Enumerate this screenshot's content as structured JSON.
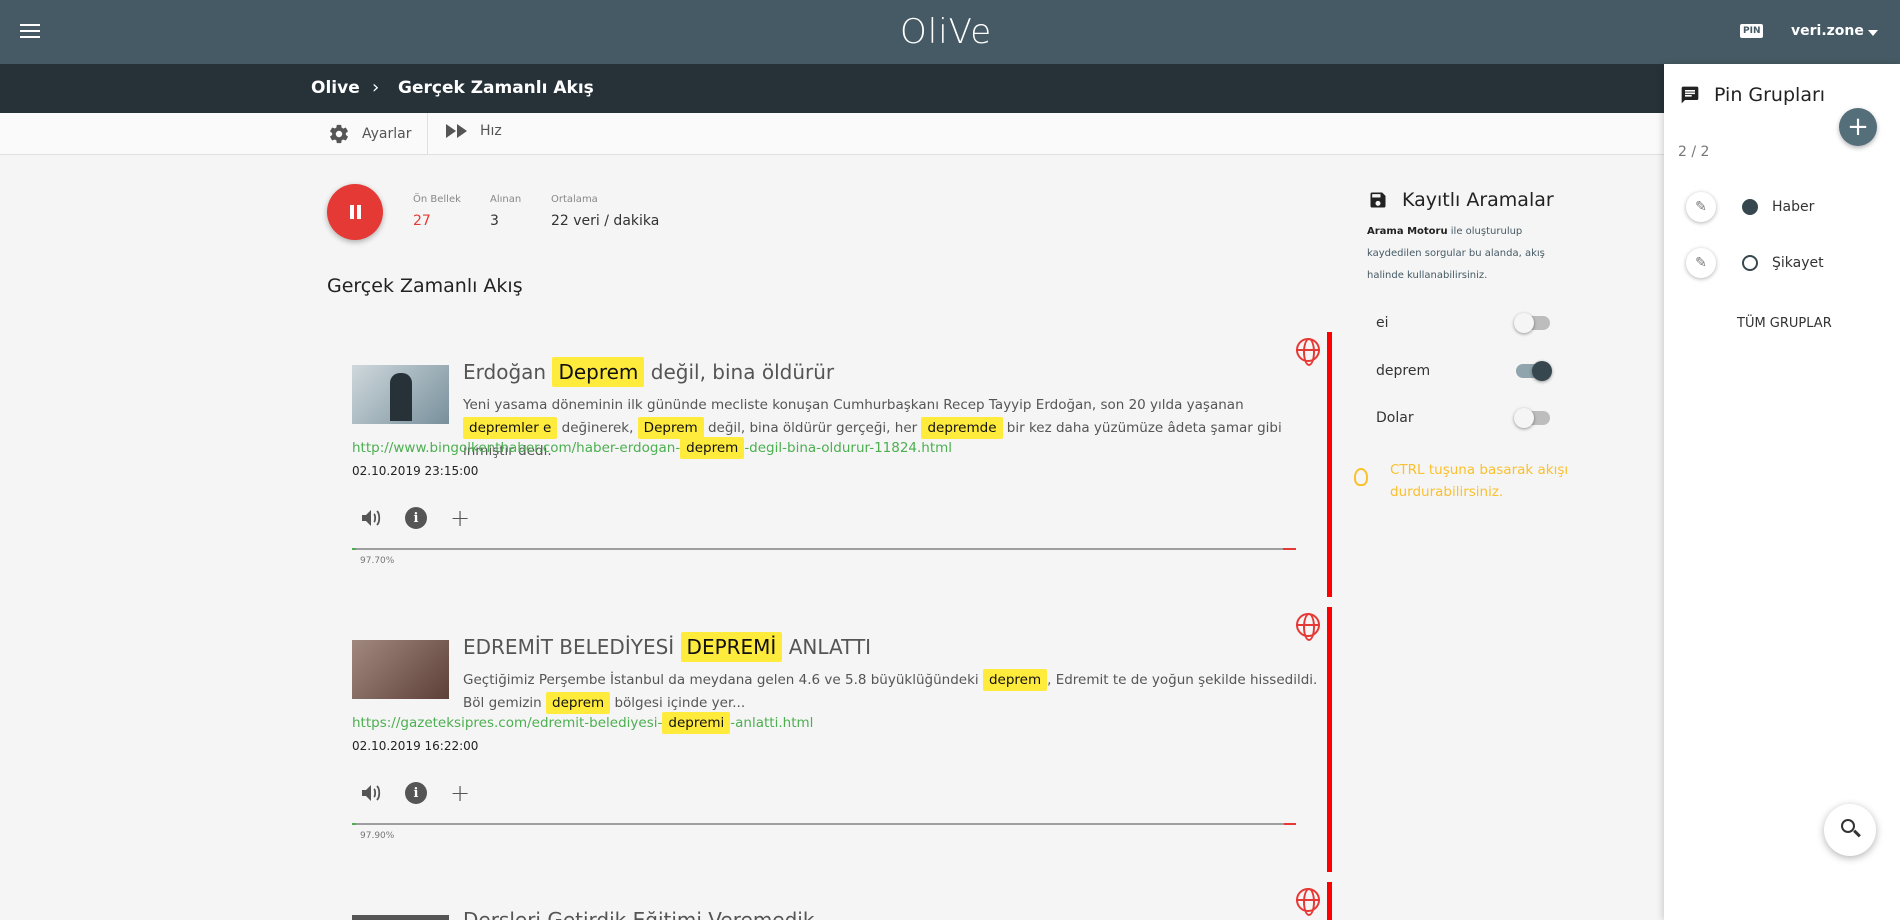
{
  "app": {
    "logo": "Oli​Ve",
    "pin_label": "PIN",
    "user": "veri.zone"
  },
  "breadcrumb": {
    "root": "Olive",
    "separator": "›",
    "current": "Gerçek Zamanlı Akış"
  },
  "toolbar": {
    "settings_label": "Ayarlar",
    "speed_label": "Hız"
  },
  "stats": [
    {
      "label": "Ön Bellek",
      "value": "27"
    },
    {
      "label": "Alınan",
      "value": "3"
    },
    {
      "label": "Ortalama",
      "value": "22 veri / dakika"
    }
  ],
  "section_title": "Gerçek Zamanlı Akış",
  "cards": [
    {
      "title_pre": "Erdoğan",
      "title_hl": "Deprem",
      "title_post": "değil, bina öldürür",
      "desc": [
        {
          "t": "Yeni yasama döneminin ilk gününde mecliste konuşan Cumhurbaşkanı Recep Tayyip Erdoğan, son 20 yılda yaşanan "
        },
        {
          "h": "depremler e"
        },
        {
          "t": " değinerek, "
        },
        {
          "h": "Deprem"
        },
        {
          "t": " değil, bina öldürür gerçeği, her "
        },
        {
          "h": "depremde"
        },
        {
          "t": " bir kez daha yüzümüze âdeta şamar gibi inmiştir dedi."
        }
      ],
      "url_pre": "http://www.bingolkenthaber.com/haber-erdogan-",
      "url_hl": "deprem",
      "url_post": "-degil-bina-oldurur-11824.html",
      "date": "02.10.2019 23:15:00",
      "progress": 97.7,
      "progress_label": "97.70%"
    },
    {
      "title_pre": "EDREMİT BELEDİYESİ",
      "title_hl": "DEPREMİ",
      "title_post": "ANLATTI",
      "desc": [
        {
          "t": "Geçtiğimiz Perşembe İstanbul da meydana gelen 4.6 ve 5.8 büyüklüğündeki "
        },
        {
          "h": "deprem"
        },
        {
          "t": ", Edremit te de yoğun şekilde hissedildi. Böl gemizin "
        },
        {
          "h": "deprem"
        },
        {
          "t": " bölgesi içinde yer..."
        }
      ],
      "url_pre": "https://gazeteksipres.com/edremit-belediyesi-",
      "url_hl": "depremi",
      "url_post": "-anlatti.html",
      "date": "02.10.2019 16:22:00",
      "progress": 97.9,
      "progress_label": "97.90%"
    }
  ],
  "partial_card_title": "Dersleri Getirdik Eğitimi Veremedik",
  "saved": {
    "title": "Kayıtlı Aramalar",
    "desc_bold": "Arama Motoru",
    "desc_rest": " ile oluşturulup kaydedilen sorgular bu alanda, akış halinde kullanabilirsiniz.",
    "items": [
      {
        "label": "ei",
        "on": false
      },
      {
        "label": "deprem",
        "on": true
      },
      {
        "label": "Dolar",
        "on": false
      }
    ],
    "tip": "CTRL tuşuna basarak akışı durdurabilirsiniz."
  },
  "panel": {
    "title": "Pin Grupları",
    "count": "2 / 2",
    "groups": [
      {
        "name": "Haber",
        "selected": true
      },
      {
        "name": "Şikayet",
        "selected": false
      }
    ],
    "all_label": "TÜM GRUPLAR"
  },
  "colors": {
    "topbar": "#455a64",
    "crumbbar": "#263238",
    "accent_red": "#e53935",
    "highlight": "#ffeb3b",
    "link_green": "#4caf50",
    "tip_yellow": "#fbc02d"
  }
}
